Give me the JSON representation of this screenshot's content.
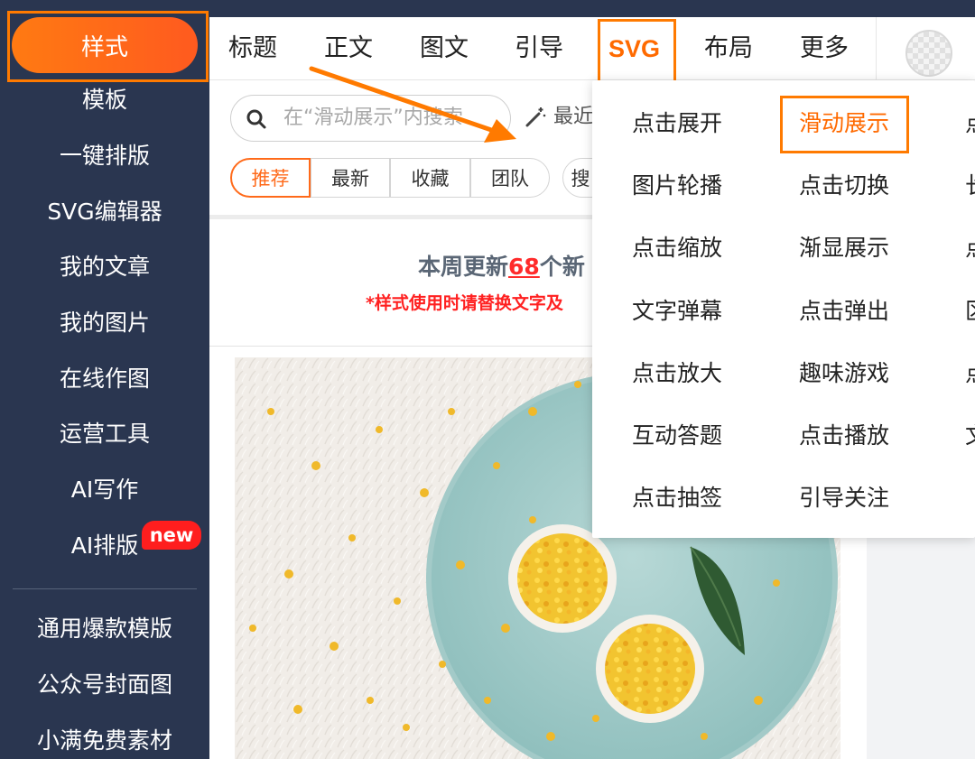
{
  "sidebar": {
    "active_label": "样式",
    "items": [
      "模板",
      "一键排版",
      "SVG编辑器",
      "我的文章",
      "我的图片",
      "在线作图",
      "运营工具",
      "AI写作",
      "AI排版"
    ],
    "lower_items": [
      "通用爆款模版",
      "公众号封面图",
      "小满免费素材"
    ],
    "new_badge": "new"
  },
  "tabs": [
    "标题",
    "正文",
    "图文",
    "引导",
    "SVG",
    "布局",
    "更多"
  ],
  "active_tab": "SVG",
  "search": {
    "placeholder": "在“滑动展示”内搜索",
    "recent_label": "最近"
  },
  "filters": [
    "推荐",
    "最新",
    "收藏",
    "团队",
    "搜"
  ],
  "notice": {
    "prefix": "本周更新",
    "count": "68",
    "suffix": "个新",
    "subtitle": "*样式使用时请替换文字及"
  },
  "dropdown": {
    "col1": [
      "点击展开",
      "图片轮播",
      "点击缩放",
      "文字弹幕",
      "点击放大",
      "互动答题",
      "点击抽签"
    ],
    "col2": [
      "滑动展示",
      "点击切换",
      "渐显展示",
      "点击弹出",
      "趣味游戏",
      "点击播放",
      "引导关注"
    ],
    "col3": [
      "点",
      "长",
      "点",
      "区",
      "点",
      "文"
    ],
    "active_item": "滑动展示"
  },
  "colors": {
    "sidebar_bg": "#2a3650",
    "accent": "#ff6a00",
    "highlight_border": "#ff7a00",
    "new_badge": "#ff1e1e"
  }
}
